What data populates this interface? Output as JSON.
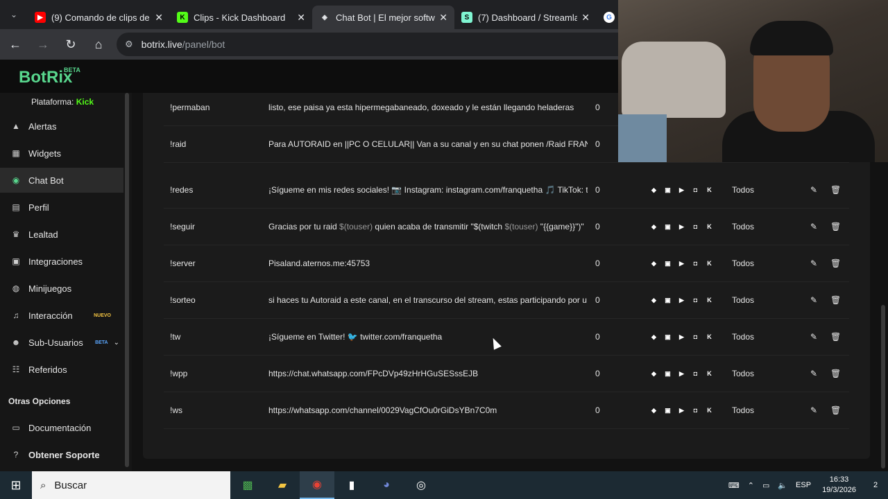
{
  "browser": {
    "tabs": [
      {
        "title": "(9) Comando de clips de",
        "icon": "youtube-icon",
        "color": "#ff0000"
      },
      {
        "title": "Clips - Kick Dashboard",
        "icon": "kick-icon",
        "color": "#53fc18"
      },
      {
        "title": "Chat Bot | El mejor softw",
        "icon": "botrix-icon",
        "color": "#e8eaed"
      },
      {
        "title": "(7) Dashboard / Streamla",
        "icon": "streamlabs-icon",
        "color": "#80f5d2"
      },
      {
        "title": "",
        "icon": "google-icon",
        "color": "#4285f4"
      }
    ],
    "url_domain": "botrix.live",
    "url_path": "/panel/bot"
  },
  "app": {
    "logo": "BotRix",
    "beta": "BETA",
    "platform_label": "Plataforma:",
    "platform_value": "Kick",
    "sidebar": [
      {
        "label": "Alertas",
        "icon": "alert-icon"
      },
      {
        "label": "Widgets",
        "icon": "widgets-icon"
      },
      {
        "label": "Chat Bot",
        "icon": "robot-icon",
        "active": true
      },
      {
        "label": "Perfil",
        "icon": "profile-icon"
      },
      {
        "label": "Lealtad",
        "icon": "trophy-icon"
      },
      {
        "label": "Integraciones",
        "icon": "integrations-icon"
      },
      {
        "label": "Minijuegos",
        "icon": "gamepad-icon"
      },
      {
        "label": "Interacción",
        "icon": "music-icon",
        "badge": "NUEVO"
      },
      {
        "label": "Sub-Usuarios",
        "icon": "users-icon",
        "badge": "BETA"
      },
      {
        "label": "Referidos",
        "icon": "referral-icon"
      }
    ],
    "other_options_title": "Otras Opciones",
    "other_options": [
      {
        "label": "Documentación",
        "icon": "doc-icon"
      },
      {
        "label": "Obtener Soporte",
        "icon": "support-icon"
      }
    ]
  },
  "commands": [
    {
      "cmd": "!permaban",
      "resp": "listo, ese paisa ya esta hipermegabaneado, doxeado y le están llegando heladeras",
      "count": "0",
      "perm": ""
    },
    {
      "cmd": "!raid",
      "resp": "Para AUTORAID en ||PC O CELULAR|| Van a su canal y en su chat ponen /Raid FRANQU",
      "count": "0",
      "perm": ""
    },
    {
      "cmd": "!redes",
      "resp": "¡Sígueme en mis redes sociales! 📷 Instagram: instagram.com/franquetha 🎵 TikTok: t",
      "count": "0",
      "perm": "Todos"
    },
    {
      "cmd": "!seguir",
      "resp_parts": [
        "Gracias por tu raid ",
        "$(touser)",
        " quien acaba de transmitir \"$(twitch ",
        "$(touser)",
        " \"{{game}}\")\""
      ],
      "count": "0",
      "perm": "Todos"
    },
    {
      "cmd": "!server",
      "resp": "Pisaland.aternos.me:45753",
      "count": "0",
      "perm": "Todos"
    },
    {
      "cmd": "!sorteo",
      "resp": "si haces tu Autoraid a este canal, en el transcurso del stream, estas participando por u",
      "count": "0",
      "perm": "Todos"
    },
    {
      "cmd": "!tw",
      "resp": "¡Sígueme en Twitter! 🐦 twitter.com/franquetha",
      "count": "0",
      "perm": "Todos"
    },
    {
      "cmd": "!wpp",
      "resp": "https://chat.whatsapp.com/FPcDVp49zHrHGuSESssEJB",
      "count": "0",
      "perm": "Todos"
    },
    {
      "cmd": "!ws",
      "resp": "https://whatsapp.com/channel/0029VagCfOu0rGiDsYBn7C0m",
      "count": "0",
      "perm": "Todos"
    }
  ],
  "taskbar": {
    "search_placeholder": "Buscar",
    "lang": "ESP",
    "time": "16:33",
    "date": "19/3/2026",
    "notifications": "2"
  }
}
